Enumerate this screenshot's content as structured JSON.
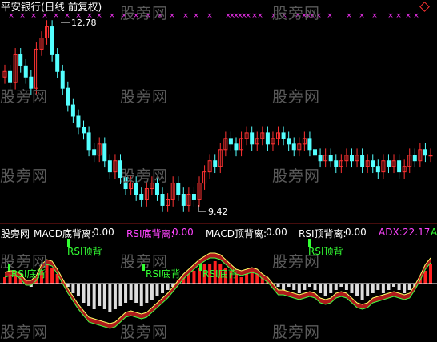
{
  "title": "平安银行(日线 前复权)",
  "max_label": "12.78",
  "min_label": "9.42",
  "watermark": "股旁网",
  "indicator_bar": {
    "source": "股旁网",
    "items": [
      {
        "label": "MACD底背离:",
        "value": "0.00",
        "color": "#ffffff"
      },
      {
        "label": "RSI底背离:",
        "value": "0.00",
        "color": "#ff44ff"
      },
      {
        "label": "MACD顶背离:",
        "value": "0.00",
        "color": "#ffffff"
      },
      {
        "label": "RSI顶背离:",
        "value": "0.00",
        "color": "#ffffff"
      },
      {
        "label": "ADX:",
        "value": "22.17",
        "color": "#ff44ff"
      }
    ],
    "tail": "A"
  },
  "signals": {
    "rsi_top_1": "RSI顶背",
    "rsi_bottom_1": "RSI底背",
    "rsi_bottom_2": "RSI底背",
    "rsi_bottom_3": "RSI底背",
    "rsi_top_2": "RSI顶背"
  },
  "colors": {
    "background": "#000000",
    "up": "#ff3232",
    "down": "#54ffff",
    "macd_pos": "#ff2020",
    "macd_neg": "#33ff33",
    "zero_line": "#ffffff",
    "marker": "#ff33ff",
    "signal_green": "#33ff33",
    "diamond": "#ff3333"
  },
  "chart_data": {
    "type": "candlestick",
    "price_max": 12.78,
    "price_min": 9.42,
    "closes": [
      11.9,
      11.7,
      12.2,
      12.0,
      11.8,
      11.6,
      12.3,
      12.5,
      12.7,
      12.2,
      11.9,
      11.6,
      11.3,
      11.1,
      10.9,
      10.8,
      10.5,
      10.4,
      10.6,
      10.3,
      10.1,
      10.3,
      10.0,
      9.8,
      9.9,
      9.7,
      9.6,
      9.8,
      9.9,
      9.7,
      9.5,
      9.6,
      9.9,
      9.7,
      9.5,
      9.7,
      9.6,
      9.9,
      10.1,
      10.3,
      10.2,
      10.5,
      10.7,
      10.6,
      10.5,
      10.7,
      10.8,
      10.6,
      10.7,
      10.8,
      10.6,
      10.7,
      10.8,
      10.7,
      10.6,
      10.5,
      10.6,
      10.7,
      10.5,
      10.4,
      10.3,
      10.4,
      10.3,
      10.2,
      10.3,
      10.4,
      10.3,
      10.4,
      10.2,
      10.3,
      10.2,
      10.1,
      10.3,
      10.2,
      10.3,
      10.1,
      10.2,
      10.4,
      10.3,
      10.5,
      10.4,
      10.4
    ],
    "macd": [
      2,
      3,
      3,
      2,
      1,
      -1,
      2,
      4,
      6,
      5,
      3,
      1,
      -1,
      -3,
      -4,
      -6,
      -7,
      -8,
      -7,
      -8,
      -9,
      -8,
      -7,
      -6,
      -5,
      -6,
      -7,
      -6,
      -5,
      -4,
      -3,
      -2,
      -1,
      1,
      2,
      3,
      4,
      5,
      6,
      6,
      7,
      6,
      5,
      4,
      3,
      2,
      3,
      4,
      3,
      2,
      1,
      0,
      -1,
      -2,
      -1,
      -2,
      -3,
      -2,
      -1,
      -2,
      -3,
      -4,
      -3,
      -2,
      -1,
      -2,
      -3,
      -4,
      -5,
      -4,
      -3,
      -2,
      -3,
      -2,
      -1,
      -2,
      -3,
      -2,
      -1,
      2,
      4,
      6
    ]
  }
}
